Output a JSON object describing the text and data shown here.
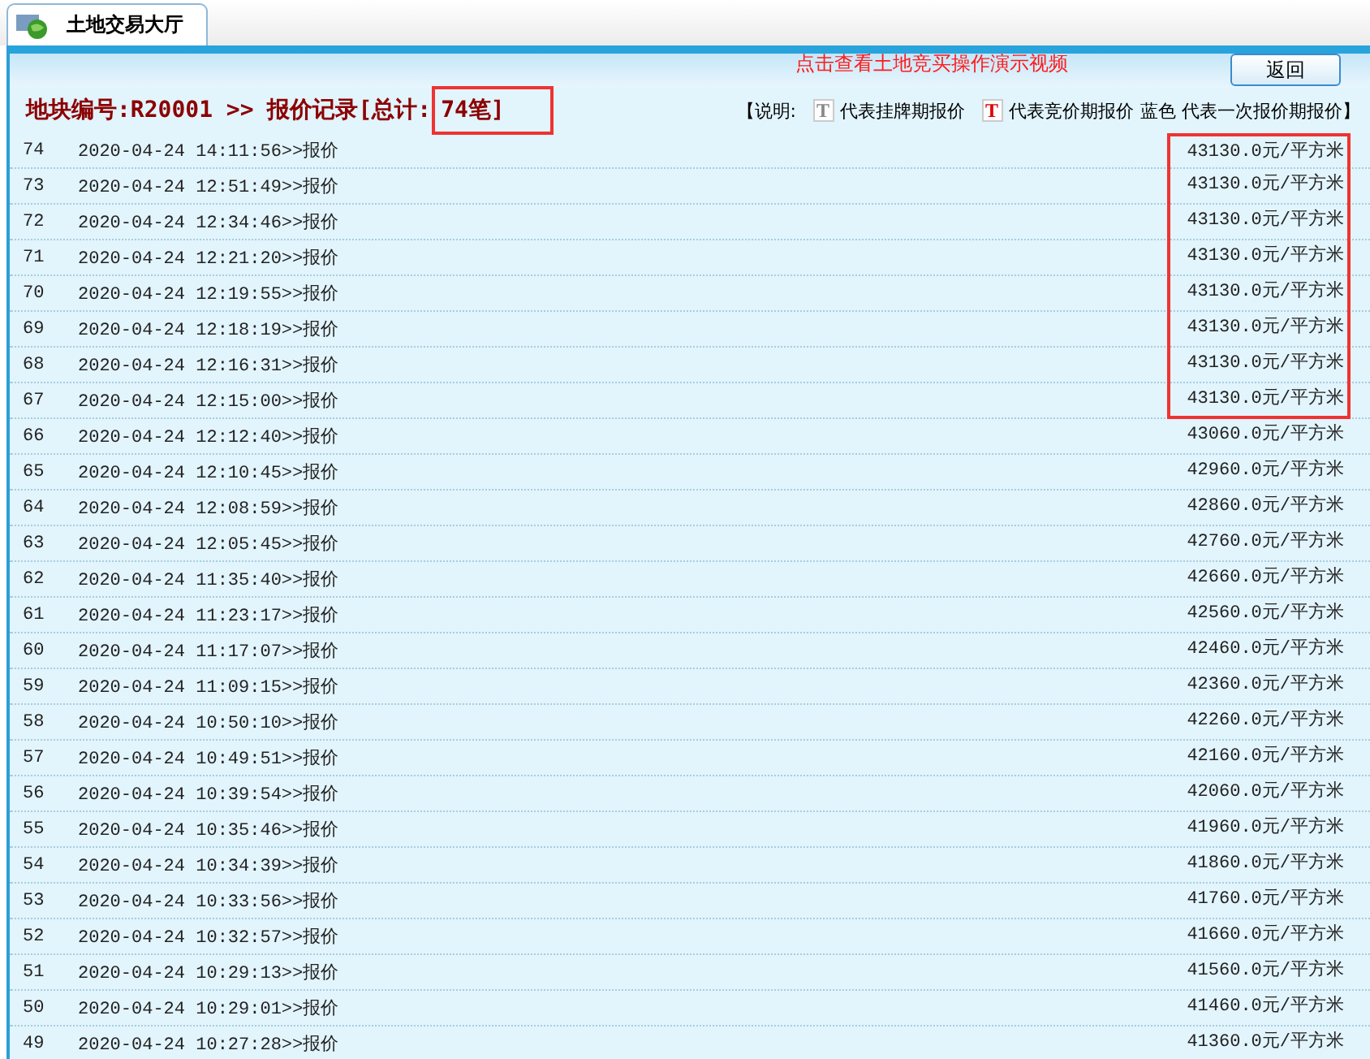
{
  "tab": {
    "label": "土地交易大厅",
    "selected": true
  },
  "video_link": "点击查看土地竞买操作演示视频",
  "back_button": "返回",
  "heading": {
    "text": "地块编号:R20001 >> 报价记录[总计:",
    "count": "74笔]",
    "count_highlighted": true
  },
  "legend": {
    "open": "【说明:",
    "items": [
      {
        "kind": "grey",
        "glyph": "T",
        "text": "代表挂牌期报价"
      },
      {
        "kind": "red",
        "glyph": "T",
        "text": "代表竞价期报价"
      },
      {
        "kind": "plain",
        "text": "蓝色 代表一次报价期报价】"
      }
    ]
  },
  "rows": [
    {
      "no": "74",
      "time": "2020-04-24 14:11:56>>报价",
      "price": "43130.0元/平方米",
      "highlighted": true
    },
    {
      "no": "73",
      "time": "2020-04-24 12:51:49>>报价",
      "price": "43130.0元/平方米",
      "highlighted": true
    },
    {
      "no": "72",
      "time": "2020-04-24 12:34:46>>报价",
      "price": "43130.0元/平方米",
      "highlighted": true
    },
    {
      "no": "71",
      "time": "2020-04-24 12:21:20>>报价",
      "price": "43130.0元/平方米",
      "highlighted": true
    },
    {
      "no": "70",
      "time": "2020-04-24 12:19:55>>报价",
      "price": "43130.0元/平方米",
      "highlighted": true
    },
    {
      "no": "69",
      "time": "2020-04-24 12:18:19>>报价",
      "price": "43130.0元/平方米",
      "highlighted": true
    },
    {
      "no": "68",
      "time": "2020-04-24 12:16:31>>报价",
      "price": "43130.0元/平方米",
      "highlighted": true
    },
    {
      "no": "67",
      "time": "2020-04-24 12:15:00>>报价",
      "price": "43130.0元/平方米",
      "highlighted": true
    },
    {
      "no": "66",
      "time": "2020-04-24 12:12:40>>报价",
      "price": "43060.0元/平方米",
      "highlighted": false
    },
    {
      "no": "65",
      "time": "2020-04-24 12:10:45>>报价",
      "price": "42960.0元/平方米",
      "highlighted": false
    },
    {
      "no": "64",
      "time": "2020-04-24 12:08:59>>报价",
      "price": "42860.0元/平方米",
      "highlighted": false
    },
    {
      "no": "63",
      "time": "2020-04-24 12:05:45>>报价",
      "price": "42760.0元/平方米",
      "highlighted": false
    },
    {
      "no": "62",
      "time": "2020-04-24 11:35:40>>报价",
      "price": "42660.0元/平方米",
      "highlighted": false
    },
    {
      "no": "61",
      "time": "2020-04-24 11:23:17>>报价",
      "price": "42560.0元/平方米",
      "highlighted": false
    },
    {
      "no": "60",
      "time": "2020-04-24 11:17:07>>报价",
      "price": "42460.0元/平方米",
      "highlighted": false
    },
    {
      "no": "59",
      "time": "2020-04-24 11:09:15>>报价",
      "price": "42360.0元/平方米",
      "highlighted": false
    },
    {
      "no": "58",
      "time": "2020-04-24 10:50:10>>报价",
      "price": "42260.0元/平方米",
      "highlighted": false
    },
    {
      "no": "57",
      "time": "2020-04-24 10:49:51>>报价",
      "price": "42160.0元/平方米",
      "highlighted": false
    },
    {
      "no": "56",
      "time": "2020-04-24 10:39:54>>报价",
      "price": "42060.0元/平方米",
      "highlighted": false
    },
    {
      "no": "55",
      "time": "2020-04-24 10:35:46>>报价",
      "price": "41960.0元/平方米",
      "highlighted": false
    },
    {
      "no": "54",
      "time": "2020-04-24 10:34:39>>报价",
      "price": "41860.0元/平方米",
      "highlighted": false
    },
    {
      "no": "53",
      "time": "2020-04-24 10:33:56>>报价",
      "price": "41760.0元/平方米",
      "highlighted": false
    },
    {
      "no": "52",
      "time": "2020-04-24 10:32:57>>报价",
      "price": "41660.0元/平方米",
      "highlighted": false
    },
    {
      "no": "51",
      "time": "2020-04-24 10:29:13>>报价",
      "price": "41560.0元/平方米",
      "highlighted": false
    },
    {
      "no": "50",
      "time": "2020-04-24 10:29:01>>报价",
      "price": "41460.0元/平方米",
      "highlighted": false
    },
    {
      "no": "49",
      "time": "2020-04-24 10:27:28>>报价",
      "price": "41360.0元/平方米",
      "highlighted": false
    }
  ]
}
